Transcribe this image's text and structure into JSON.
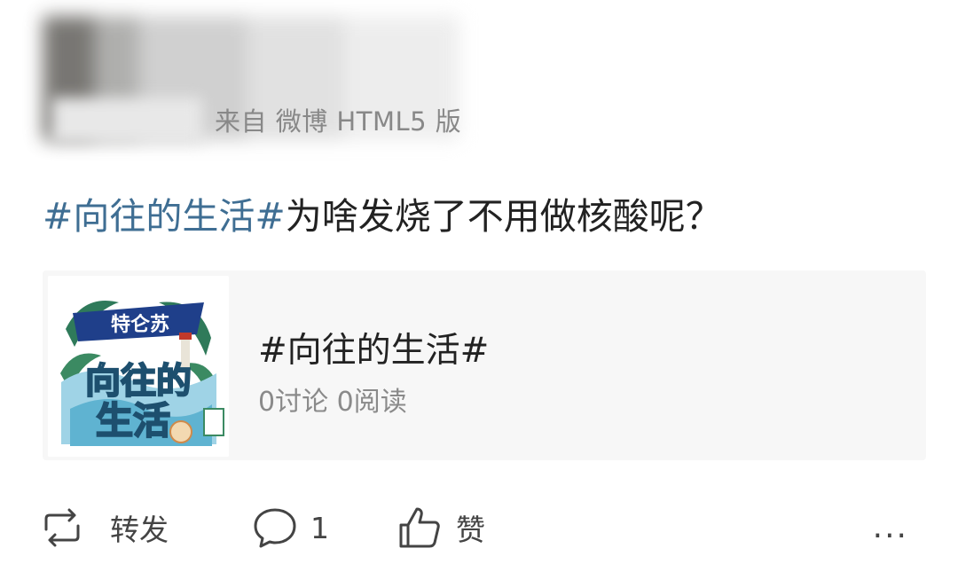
{
  "header": {
    "source_text": "来自 微博 HTML5 版"
  },
  "post": {
    "hashtag": "#向往的生活#",
    "text": "为啥发烧了不用做核酸呢？"
  },
  "topic_card": {
    "thumbnail_brand": "特仑苏",
    "thumbnail_title_line1": "向往的",
    "thumbnail_title_line2": "生活",
    "title": "#向往的生活#",
    "meta": "0讨论 0阅读"
  },
  "actions": {
    "repost_label": "转发",
    "comment_count": "1",
    "like_label": "赞",
    "more_label": "..."
  },
  "colors": {
    "hashtag": "#3f6e93",
    "card_background": "#f7f7f7",
    "meta_text": "#8a8a8a"
  },
  "icons": [
    "repost-icon",
    "comment-icon",
    "like-icon",
    "more-icon"
  ]
}
